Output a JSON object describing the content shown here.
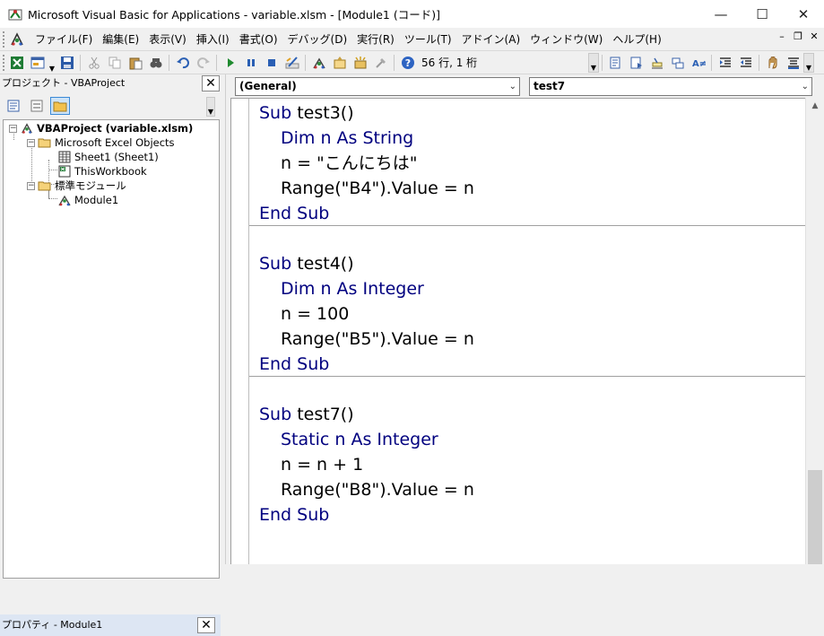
{
  "window": {
    "title": "Microsoft Visual Basic for Applications - variable.xlsm - [Module1 (コード)]",
    "controls": {
      "minimize": "—",
      "maximize": "☐",
      "close": "✕"
    }
  },
  "menubar": {
    "items": [
      "ファイル(F)",
      "編集(E)",
      "表示(V)",
      "挿入(I)",
      "書式(O)",
      "デバッグ(D)",
      "実行(R)",
      "ツール(T)",
      "アドイン(A)",
      "ウィンドウ(W)",
      "ヘルプ(H)"
    ],
    "mdi": {
      "minimize": "–",
      "restore": "❐",
      "close": "✕"
    }
  },
  "toolbar": {
    "position_readout": "56 行, 1 桁"
  },
  "project_pane": {
    "title": "プロジェクト - VBAProject",
    "close": "✕",
    "tree": {
      "root": "VBAProject (variable.xlsm)",
      "excel_objects": "Microsoft Excel Objects",
      "sheet1": "Sheet1 (Sheet1)",
      "thisworkbook": "ThisWorkbook",
      "modules": "標準モジュール",
      "module1": "Module1"
    }
  },
  "properties_pane": {
    "title": "プロパティ - Module1",
    "close": "✕"
  },
  "editor": {
    "object_combo": "(General)",
    "procedure_combo": "test7",
    "lines": [
      {
        "kw": "Sub",
        "rest": " test3()"
      },
      {
        "kw": "Dim",
        "rest": " n As String",
        "kw2": "",
        "indent": true
      },
      {
        "text": "n = \"こんにちは\"",
        "indent": true
      },
      {
        "text": "Range(\"B4\").Value = n",
        "indent": true
      },
      {
        "kw": "End Sub",
        "rest": ""
      },
      {
        "kw": "Sub",
        "rest": " test4()"
      },
      {
        "kw": "Dim",
        "rest": " n As Integer",
        "indent": true
      },
      {
        "text": "n = 100",
        "indent": true
      },
      {
        "text": "Range(\"B5\").Value = n",
        "indent": true
      },
      {
        "kw": "End Sub",
        "rest": ""
      },
      {
        "kw": "Sub",
        "rest": " test7()"
      },
      {
        "kw": "Static",
        "rest": " n As Integer",
        "indent": true
      },
      {
        "text": "n = n + 1",
        "indent": true
      },
      {
        "text": "Range(\"B8\").Value = n",
        "indent": true
      },
      {
        "kw": "End Sub",
        "rest": ""
      }
    ]
  }
}
